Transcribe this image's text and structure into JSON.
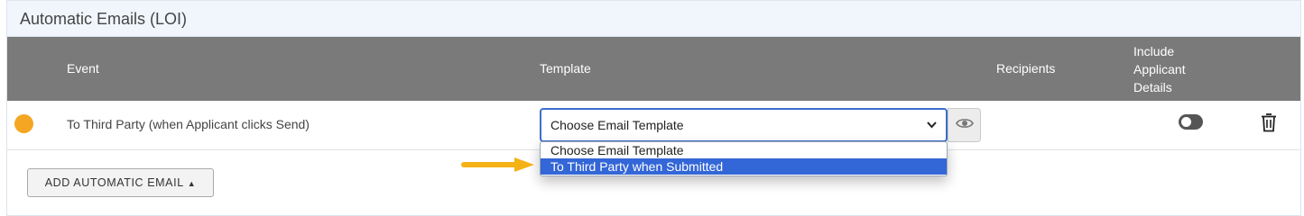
{
  "panel": {
    "title": "Automatic Emails (LOI)"
  },
  "table": {
    "headers": {
      "event": "Event",
      "template": "Template",
      "recipients": "Recipients",
      "include_line1": "Include",
      "include_line2": "Applicant",
      "include_line3": "Details"
    },
    "rows": [
      {
        "status_color": "#f5a623",
        "event": "To Third Party (when Applicant clicks Send)",
        "template_selected": "Choose Email Template",
        "include_applicant_details": false
      }
    ]
  },
  "dropdown": {
    "options": [
      "Choose Email Template",
      "To Third Party when Submitted"
    ],
    "highlighted": "To Third Party when Submitted"
  },
  "actions": {
    "add_label": "ADD AUTOMATIC EMAIL"
  },
  "colors": {
    "accent": "#3366d6",
    "header_bg": "#7a7a7a",
    "status": "#f5a623",
    "arrow": "#f4b214"
  }
}
